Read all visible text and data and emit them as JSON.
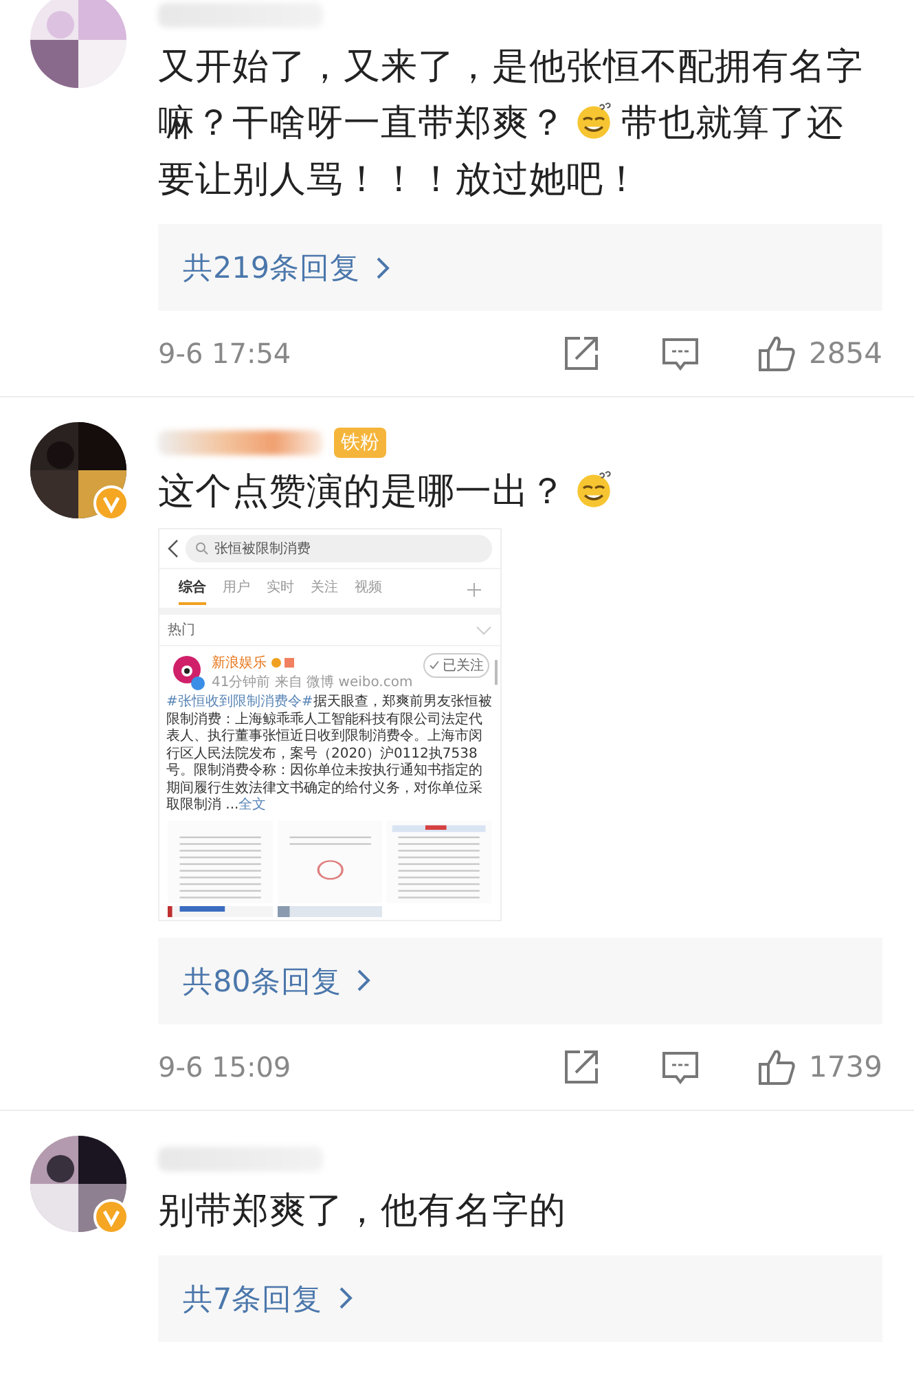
{
  "comments": [
    {
      "segments": [
        {
          "kind": "text",
          "text": "又开始了，又来了，是他张恒不配拥有名字"
        },
        {
          "kind": "break"
        },
        {
          "kind": "text",
          "text": "嘛？干啥呀一直带郑爽？"
        },
        {
          "kind": "emoji"
        },
        {
          "kind": "text",
          "text": "带也就算了还"
        },
        {
          "kind": "break"
        },
        {
          "kind": "text",
          "text": "要让别人骂！！！放过她吧！"
        }
      ],
      "replies": "共219条回复",
      "date": "9-6 17:54",
      "likes": "2854"
    },
    {
      "verified": true,
      "badge": "铁粉",
      "segments": [
        {
          "kind": "text",
          "text": "这个点赞演的是哪一出？"
        },
        {
          "kind": "emoji"
        }
      ],
      "embed": {
        "search": "张恒被限制消费",
        "tabs": [
          {
            "label": "综合",
            "selected": true
          },
          {
            "label": "用户",
            "selected": false
          },
          {
            "label": "实时",
            "selected": false
          },
          {
            "label": "关注",
            "selected": false
          },
          {
            "label": "视频",
            "selected": false
          }
        ],
        "section": "热门",
        "author": "新浪娱乐",
        "follow": "已关注",
        "meta": "41分钟前  来自 微博 weibo.com",
        "hashtag": "#张恒收到限制消费令#",
        "body": "据天眼查，郑爽前男友张恒被限制消费：上海鲸乖乖人工智能科技有限公司法定代表人、执行董事张恒近日收到限制消费令。上海市闵行区人民法院发布，案号（2020）沪0112执7538号。限制消费令称：因你单位未按执行通知书指定的期间履行生效法律文书确定的给付义务，对你单位采取限制消 ...",
        "more": "全文"
      },
      "replies": "共80条回复",
      "date": "9-6 15:09",
      "likes": "1739"
    },
    {
      "verified": true,
      "segments": [
        {
          "kind": "text",
          "text": "别带郑爽了，他有名字的"
        }
      ],
      "replies": "共7条回复"
    }
  ]
}
